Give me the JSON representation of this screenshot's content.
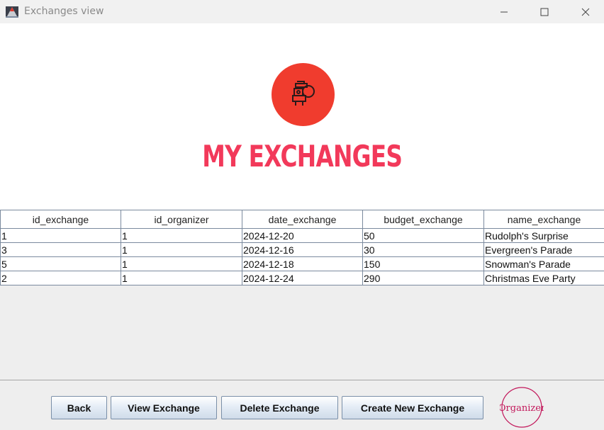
{
  "window": {
    "title": "Exchanges view",
    "controls": {
      "minimize": "minimize-icon",
      "maximize": "maximize-icon",
      "close": "close-icon"
    }
  },
  "header": {
    "logo_icon": "santa-icon",
    "headline": "MY EXCHANGES",
    "accent_color": "#f2395a",
    "logo_bg_color": "#f03c2e"
  },
  "table": {
    "columns": [
      "id_exchange",
      "id_organizer",
      "date_exchange",
      "budget_exchange",
      "name_exchange"
    ],
    "rows": [
      [
        "1",
        "1",
        "2024-12-20",
        "50",
        "Rudolph's Surprise"
      ],
      [
        "3",
        "1",
        "2024-12-16",
        "30",
        "Evergreen's Parade"
      ],
      [
        "5",
        "1",
        "2024-12-18",
        "150",
        "Snowman's Parade"
      ],
      [
        "2",
        "1",
        "2024-12-24",
        "290",
        "Christmas Eve Party"
      ]
    ]
  },
  "buttons": {
    "back": "Back",
    "view": "View Exchange",
    "delete": "Delete Exchange",
    "create": "Create New Exchange"
  },
  "brand": {
    "organizer_text": "Organizer",
    "organizer_color": "#c2185b"
  }
}
